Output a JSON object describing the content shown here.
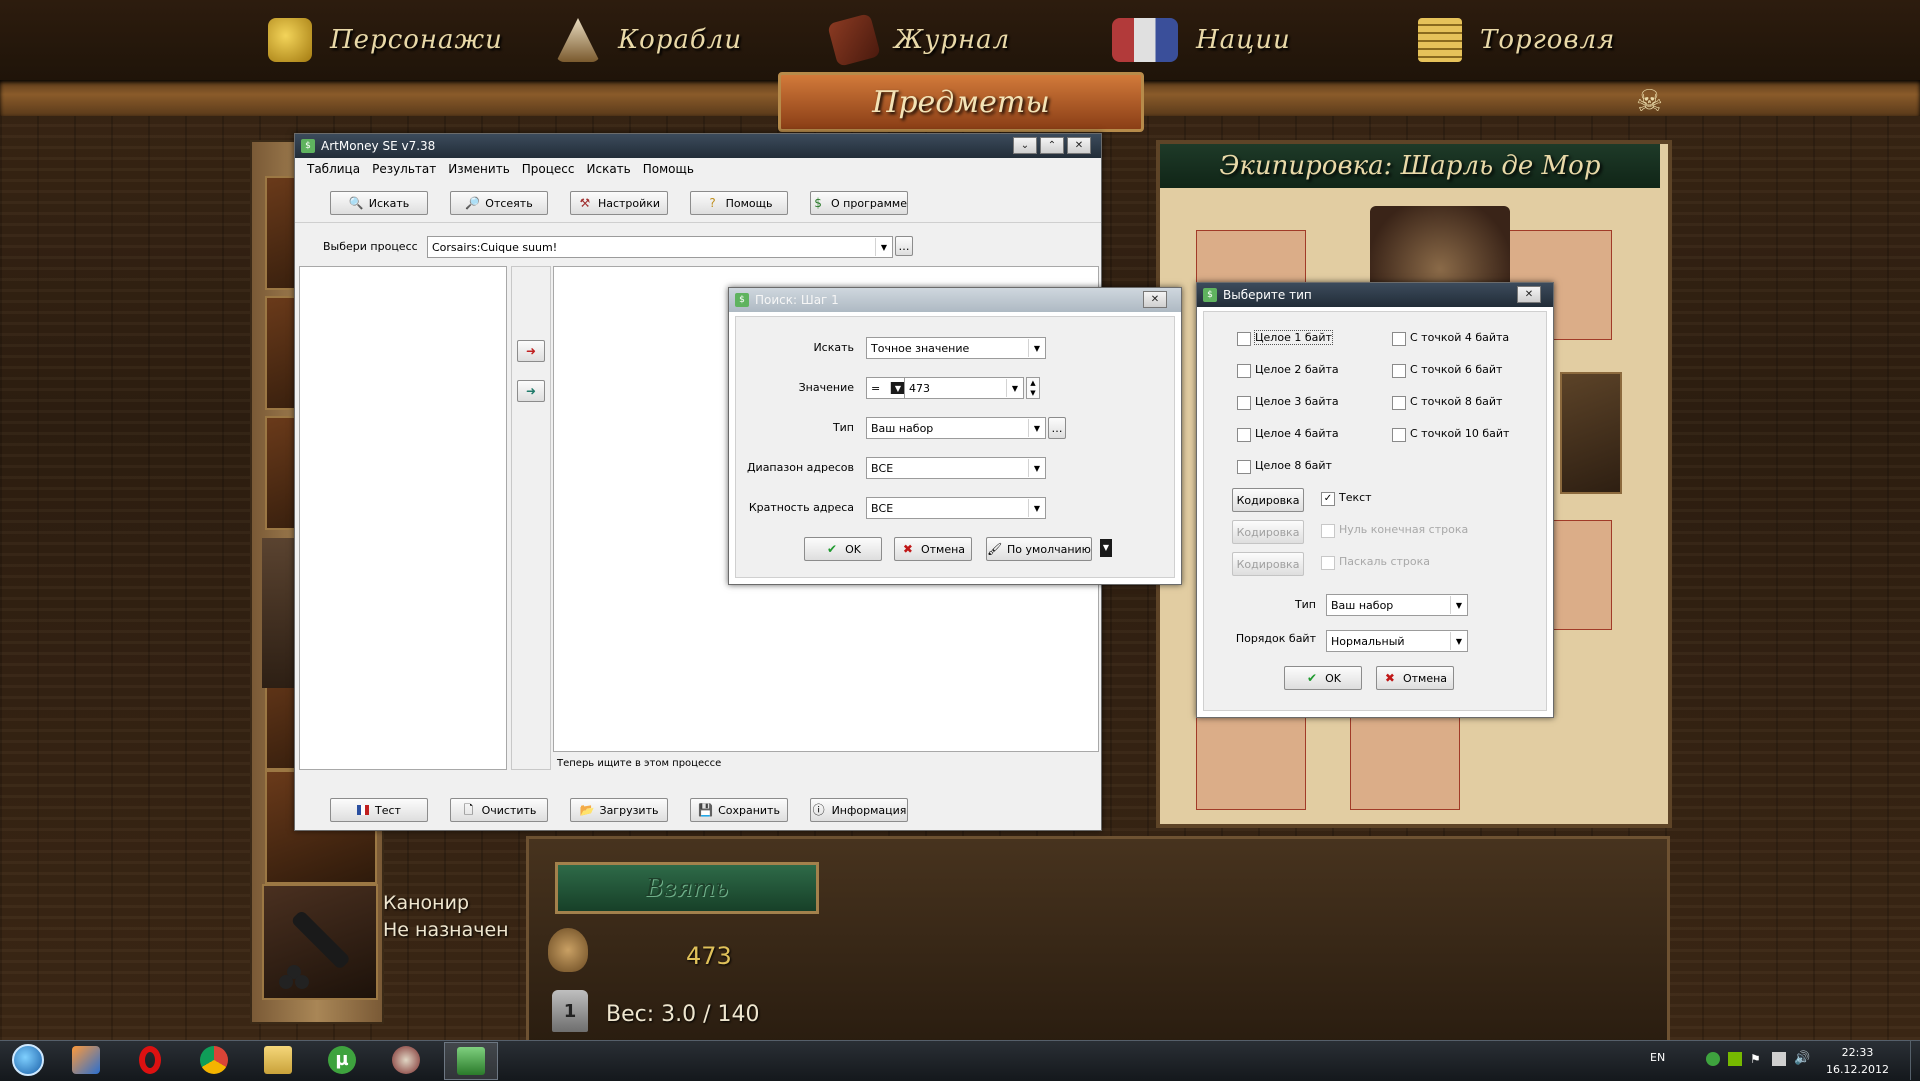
{
  "game": {
    "nav": [
      {
        "label": "Персонажи",
        "icon": "bust-icon"
      },
      {
        "label": "Корабли",
        "icon": "ship-icon"
      },
      {
        "label": "Журнал",
        "icon": "journal-icon"
      },
      {
        "label": "Нации",
        "icon": "flags-icon"
      },
      {
        "label": "Торговля",
        "icon": "coins-icon"
      }
    ],
    "items_tab": "Предметы",
    "equip_title": "Экипировка: Шарль де Мор",
    "cannoneer_line1": "Канонир",
    "cannoneer_line2": "Не назначен",
    "take_button": "Взять",
    "gold": "473",
    "weight": "Вес: 3.0 / 140"
  },
  "artmoney": {
    "title": "ArtMoney SE v7.38",
    "menu": [
      "Таблица",
      "Результат",
      "Изменить",
      "Процесс",
      "Искать",
      "Помощь"
    ],
    "toolbar": [
      {
        "label": "Искать",
        "icon": "search-icon"
      },
      {
        "label": "Отсеять",
        "icon": "filter-icon"
      },
      {
        "label": "Настройки",
        "icon": "settings-icon"
      },
      {
        "label": "Помощь",
        "icon": "help-icon"
      },
      {
        "label": "О программе",
        "icon": "about-icon"
      }
    ],
    "process_label": "Выбери процесс",
    "process_value": "Corsairs:Cuique suum!",
    "status": "Теперь ищите в этом процессе",
    "bottom": [
      {
        "label": "Тест",
        "icon": "flag-icon"
      },
      {
        "label": "Очистить",
        "icon": "clear-icon"
      },
      {
        "label": "Загрузить",
        "icon": "open-icon"
      },
      {
        "label": "Сохранить",
        "icon": "save-icon"
      },
      {
        "label": "Информация",
        "icon": "info-icon"
      }
    ]
  },
  "search_dialog": {
    "title": "Поиск: Шаг 1",
    "search_label": "Искать",
    "search_value": "Точное значение",
    "value_label": "Значение",
    "value_op": "=",
    "value": "473",
    "type_label": "Тип",
    "type_value": "Ваш набор",
    "range_label": "Диапазон адресов",
    "range_value": "ВСЕ",
    "align_label": "Кратность адреса",
    "align_value": "ВСЕ",
    "ok": "OK",
    "cancel": "Отмена",
    "default": "По умолчанию"
  },
  "type_dialog": {
    "title": "Выберите тип",
    "left_options": [
      {
        "label": "Целое 1 байт",
        "checked": false
      },
      {
        "label": "Целое 2 байта",
        "checked": false
      },
      {
        "label": "Целое 3 байта",
        "checked": false
      },
      {
        "label": "Целое 4 байта",
        "checked": false
      },
      {
        "label": "Целое 8 байт",
        "checked": false
      }
    ],
    "right_options": [
      {
        "label": "С точкой 4 байта",
        "checked": false
      },
      {
        "label": "С точкой 6 байт",
        "checked": false
      },
      {
        "label": "С точкой 8 байт",
        "checked": false
      },
      {
        "label": "С точкой 10 байт",
        "checked": false
      }
    ],
    "encoding_btn": "Кодировка",
    "text_option": "Текст",
    "null_option": "Нуль конечная строка",
    "pascal_option": "Паскаль строка",
    "type_label": "Тип",
    "type_value": "Ваш набор",
    "order_label": "Порядок байт",
    "order_value": "Нормальный",
    "ok": "OK",
    "cancel": "Отмена"
  },
  "taskbar": {
    "lang": "EN",
    "time": "22:33",
    "date": "16.12.2012"
  }
}
